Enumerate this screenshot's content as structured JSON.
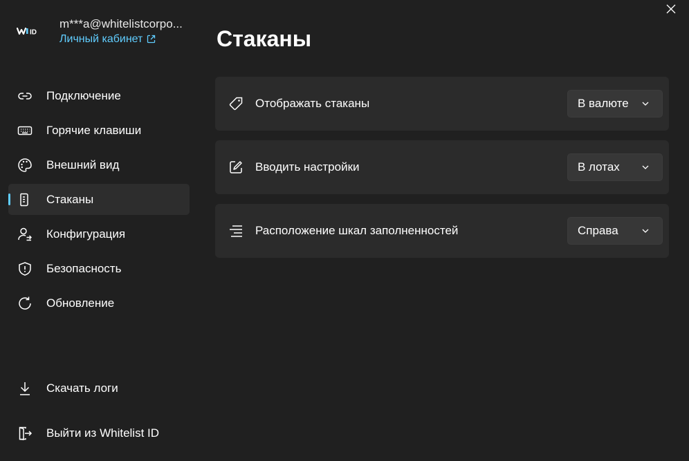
{
  "window": {
    "close_icon": "close-icon"
  },
  "account": {
    "logo_icon": "whitelist-id-logo",
    "logo_text": "ID",
    "email": "m***a@whitelistcorpo...",
    "cabinet_link": "Личный кабинет",
    "external_link_icon": "external-link-icon"
  },
  "sidebar": {
    "items": [
      {
        "id": "connection",
        "label": "Подключение",
        "icon": "link-icon",
        "active": false
      },
      {
        "id": "hotkeys",
        "label": "Горячие клавиши",
        "icon": "keyboard-icon",
        "active": false
      },
      {
        "id": "appearance",
        "label": "Внешний вид",
        "icon": "palette-icon",
        "active": false
      },
      {
        "id": "orderbooks",
        "label": "Стаканы",
        "icon": "orderbook-icon",
        "active": true
      },
      {
        "id": "configuration",
        "label": "Конфигурация",
        "icon": "user-sync-icon",
        "active": false
      },
      {
        "id": "security",
        "label": "Безопасность",
        "icon": "shield-icon",
        "active": false
      },
      {
        "id": "update",
        "label": "Обновление",
        "icon": "refresh-icon",
        "active": false
      }
    ],
    "download_logs": {
      "label": "Скачать логи",
      "icon": "download-icon"
    },
    "logout": {
      "label": "Выйти из Whitelist ID",
      "icon": "sign-out-icon"
    }
  },
  "main": {
    "title": "Стаканы",
    "settings": [
      {
        "label": "Отображать стаканы",
        "icon": "tag-icon",
        "value": "В валюте"
      },
      {
        "label": "Вводить настройки",
        "icon": "edit-icon",
        "value": "В лотах"
      },
      {
        "label": "Расположение шкал заполненностей",
        "icon": "align-right-icon",
        "value": "Справа"
      }
    ]
  },
  "colors": {
    "background": "#202020",
    "card": "#2b2b2b",
    "accent": "#60cdff",
    "dropdown": "#373737"
  }
}
